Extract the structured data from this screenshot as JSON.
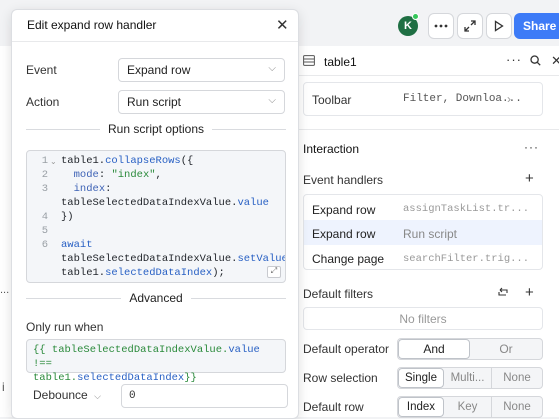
{
  "topbar": {
    "avatar_initial": "K",
    "share_label": "Share"
  },
  "right_panel": {
    "title": "table1",
    "toolbar": {
      "label": "Toolbar",
      "value": "Filter, Downloa..."
    },
    "interaction": {
      "title": "Interaction"
    },
    "event_handlers": {
      "title": "Event handlers",
      "rows": [
        {
          "event": "Expand row",
          "action": "assignTaskList.tr..."
        },
        {
          "event": "Expand row",
          "action": "Run script"
        },
        {
          "event": "Change page",
          "action": "searchFilter.trig..."
        }
      ]
    },
    "default_filters": {
      "title": "Default filters",
      "empty": "No filters"
    },
    "default_operator": {
      "label": "Default operator",
      "options": [
        "And",
        "Or"
      ],
      "selected": "And"
    },
    "row_selection": {
      "label": "Row selection",
      "options": [
        "Single",
        "Multi...",
        "None"
      ],
      "selected": "Single"
    },
    "default_row": {
      "label": "Default row",
      "options": [
        "Index",
        "Key",
        "None"
      ],
      "selected": "Index"
    }
  },
  "modal": {
    "title": "Edit expand row handler",
    "event": {
      "label": "Event",
      "value": "Expand row"
    },
    "action": {
      "label": "Action",
      "value": "Run script"
    },
    "run_script_options": "Run script options",
    "code_numbers": [
      "1",
      "2",
      "3",
      "",
      "4",
      "5",
      "6",
      "",
      ""
    ],
    "advanced": "Advanced",
    "only_run_when": {
      "label": "Only run when",
      "line1": "{{ tableSelectedDataIndexValue.value !==",
      "line2": "table1.selectedDataIndex}}"
    },
    "debounce": {
      "label": "Debounce",
      "value": "0"
    }
  },
  "left_fragments": {
    "dots": "...",
    "letter": "i"
  }
}
